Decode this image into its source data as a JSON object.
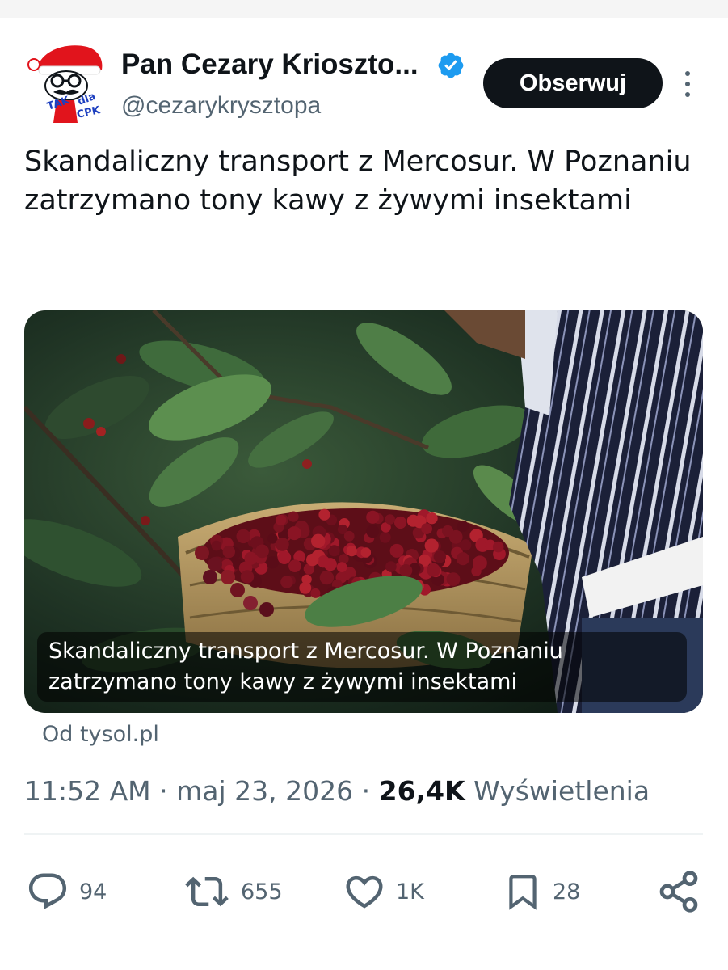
{
  "author": {
    "display_name": "Pan Cezary Krioszto...",
    "handle": "@cezarykrysztopa",
    "avatar_text": "TAK dla CPK",
    "verified": true
  },
  "follow_button": {
    "label": "Obserwuj"
  },
  "tweet": {
    "text": "Skandaliczny transport z Mercosur. W Poznaniu zatrzymano tony kawy z żywymi insektami"
  },
  "card": {
    "image_subject": "coffee-cherries-basket",
    "caption": "Skandaliczny transport z Mercosur. W Poznaniu zatrzymano tony kawy z żywymi insektami",
    "source": "Od tysol.pl"
  },
  "meta": {
    "time": "11:52 AM",
    "separator": "·",
    "date": "maj 23, 2026",
    "views_count": "26,4K",
    "views_label": "Wyświetlenia"
  },
  "actions": {
    "replies": "94",
    "reposts": "655",
    "likes": "1K",
    "bookmarks": "28"
  },
  "colors": {
    "text_primary": "#0f1419",
    "text_secondary": "#536471",
    "verified_blue": "#1d9bf0",
    "button_bg": "#0f1419",
    "avatar_red": "#e1141c"
  }
}
